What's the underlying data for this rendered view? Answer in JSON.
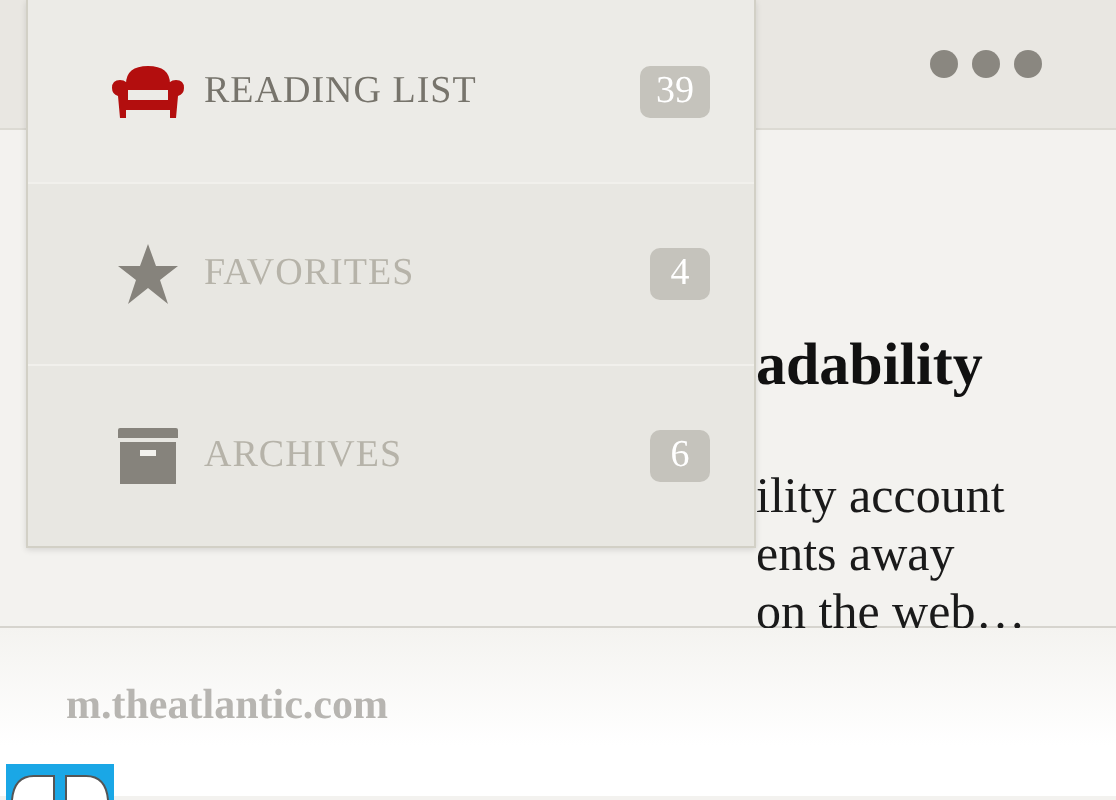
{
  "menu": {
    "items": [
      {
        "kind": "reading-list",
        "label": "READING LIST",
        "count": "39",
        "selected": true
      },
      {
        "kind": "favorites",
        "label": "FAVORITES",
        "count": "4",
        "selected": false
      },
      {
        "kind": "archives",
        "label": "ARCHIVES",
        "count": "6",
        "selected": false
      }
    ]
  },
  "article": {
    "heading": "adability",
    "lines": [
      "ility account",
      "ents away",
      "on the web…"
    ]
  },
  "footer": {
    "source": "m.theatlantic.com"
  }
}
